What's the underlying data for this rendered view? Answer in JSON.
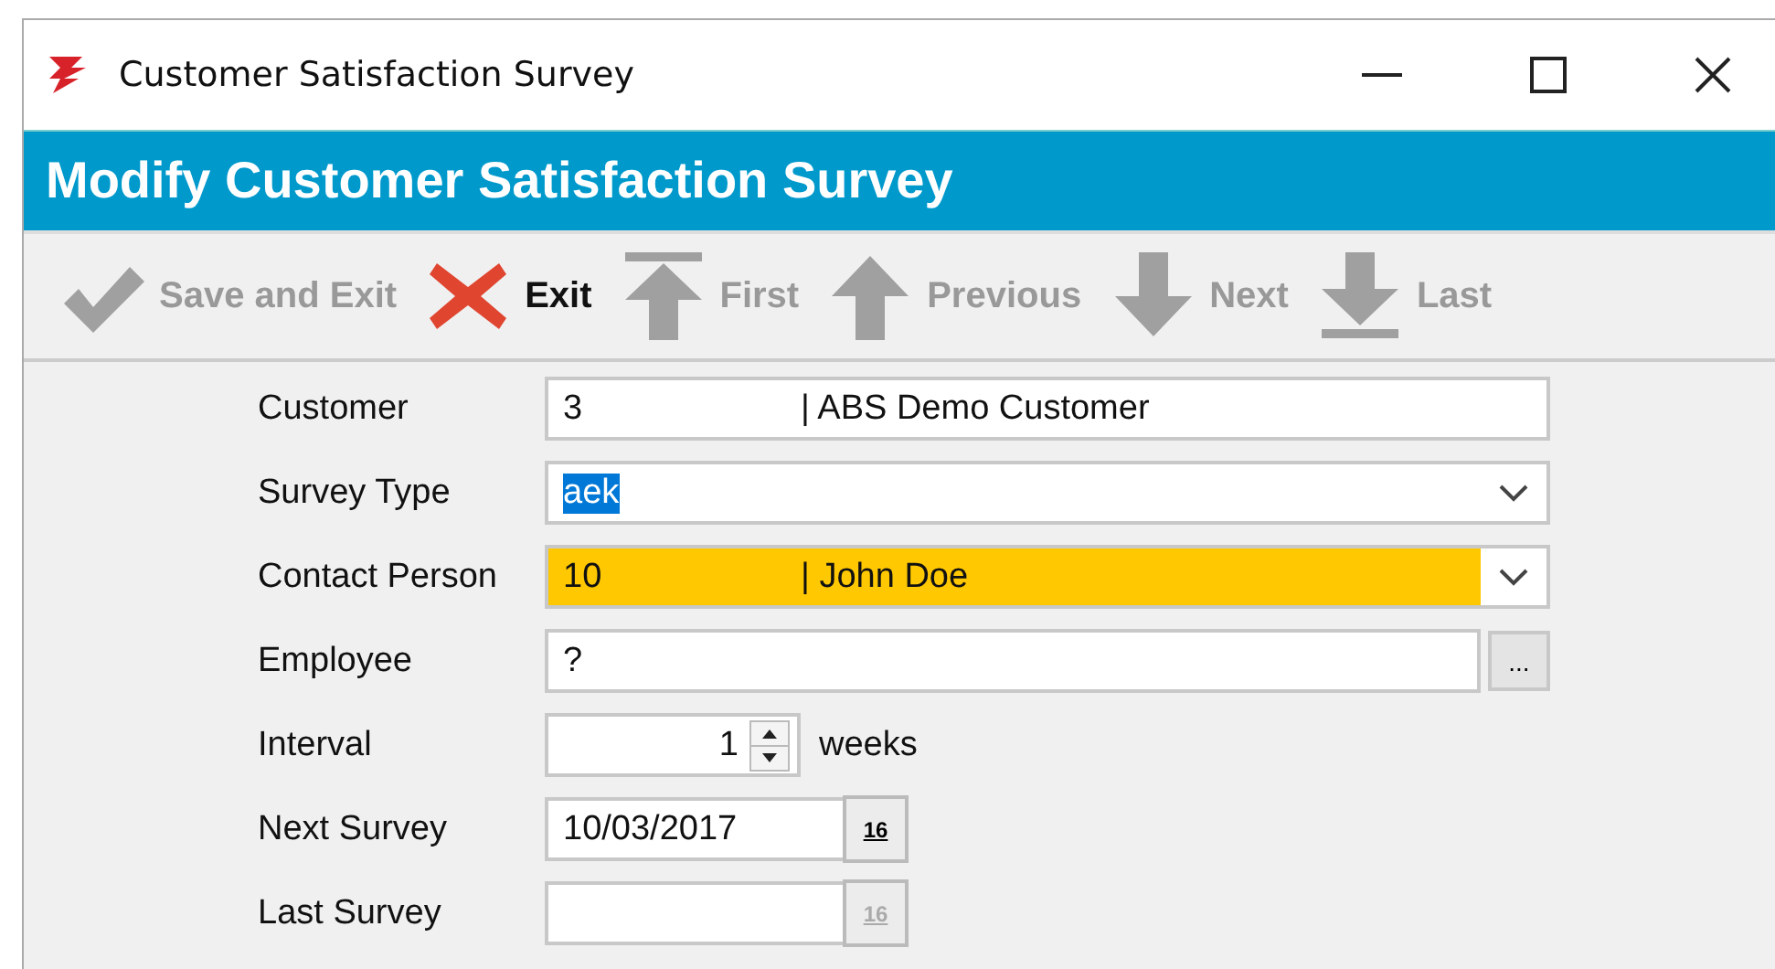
{
  "window": {
    "title": "Customer Satisfaction Survey"
  },
  "header": "Modify Customer Satisfaction Survey",
  "toolbar": [
    {
      "label": "Save and Exit",
      "kind": "check",
      "disabled": true
    },
    {
      "label": "Exit",
      "kind": "cross",
      "disabled": false
    },
    {
      "label": "First",
      "kind": "first",
      "disabled": true
    },
    {
      "label": "Previous",
      "kind": "up",
      "disabled": true
    },
    {
      "label": "Next",
      "kind": "down",
      "disabled": true
    },
    {
      "label": "Last",
      "kind": "last",
      "disabled": true
    }
  ],
  "fields": [
    {
      "label": "Customer",
      "kind": "text",
      "code": "3",
      "name": "| ABS Demo Customer",
      "highlighted": false
    },
    {
      "label": "Survey Type",
      "kind": "dropdown",
      "value": "aek",
      "text_selected": true,
      "highlighted": false
    },
    {
      "label": "Contact Person",
      "kind": "dropdown",
      "code": "10",
      "name": "| John Doe",
      "highlighted": true
    },
    {
      "label": "Employee",
      "kind": "lookup",
      "value": "?",
      "button": "...",
      "highlighted": false
    },
    {
      "label": "Interval",
      "kind": "spinner",
      "value": "1",
      "unit": "weeks",
      "highlighted": false
    },
    {
      "label": "Next Survey",
      "kind": "date",
      "value": "10/03/2017",
      "calendar": "16",
      "disabled": false,
      "highlighted": false
    },
    {
      "label": "Last Survey",
      "kind": "date",
      "calendar": "16",
      "disabled": true,
      "highlighted": false
    }
  ]
}
